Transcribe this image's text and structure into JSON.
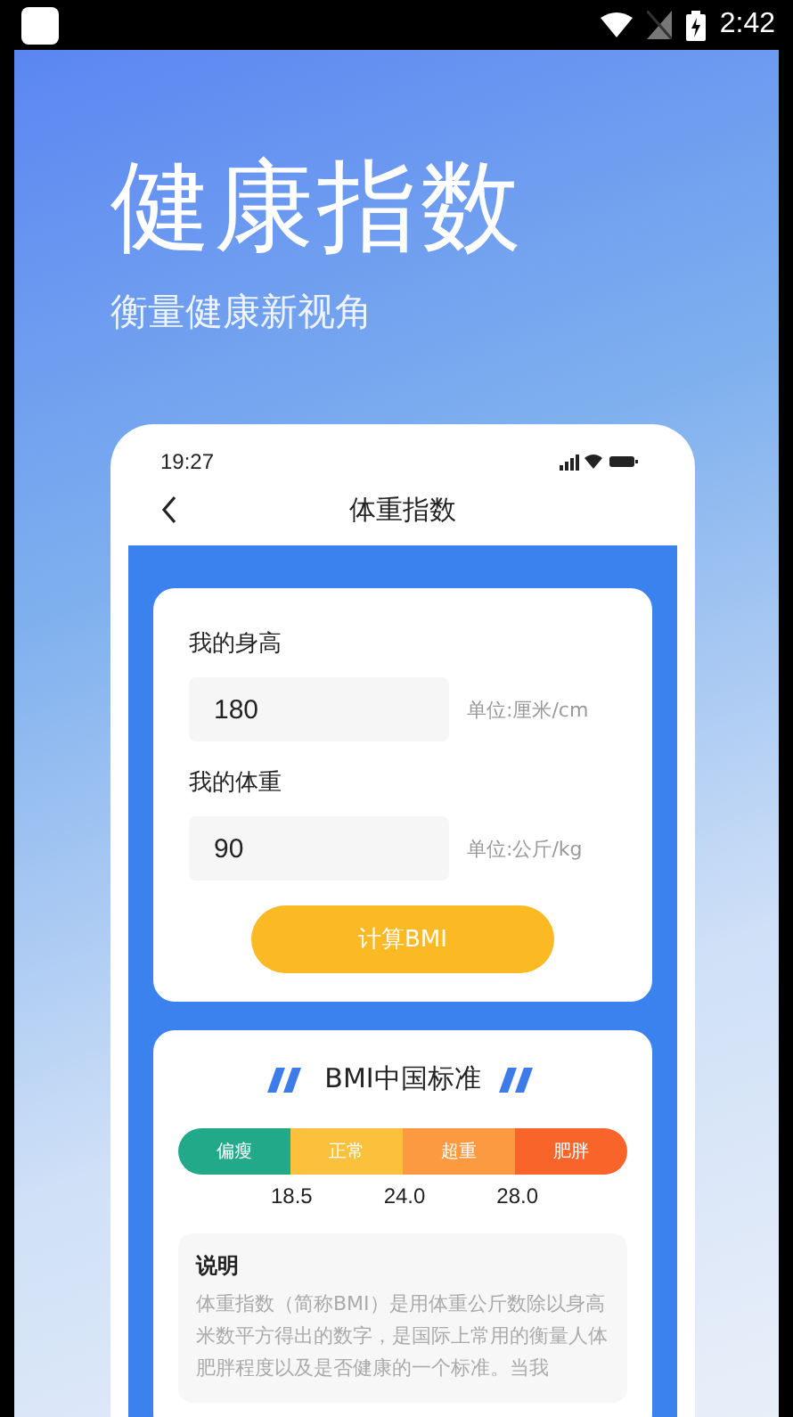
{
  "status_bar": {
    "time": "2:42"
  },
  "banner": {
    "title": "健康指数",
    "subtitle": "衡量健康新视角"
  },
  "phone": {
    "time": "19:27",
    "header": {
      "title": "体重指数"
    },
    "form": {
      "fields": [
        {
          "label": "我的身高",
          "value": "180",
          "unit": "单位:厘米/cm"
        },
        {
          "label": "我的体重",
          "value": "90",
          "unit": "单位:公斤/kg"
        }
      ],
      "button": "计算BMI"
    },
    "standard": {
      "title": "BMI中国标准",
      "segments": [
        {
          "label": "偏瘦",
          "color": "#22a98a"
        },
        {
          "label": "正常",
          "color": "#fcc13c"
        },
        {
          "label": "超重",
          "color": "#fb9a40"
        },
        {
          "label": "肥胖",
          "color": "#f8642a"
        }
      ],
      "ticks": [
        "18.5",
        "24.0",
        "28.0"
      ],
      "note": {
        "title": "说明",
        "text": "体重指数（简称BMI）是用体重公斤数除以身高米数平方得出的数字，是国际上常用的衡量人体肥胖程度以及是否健康的一个标准。当我"
      }
    }
  }
}
